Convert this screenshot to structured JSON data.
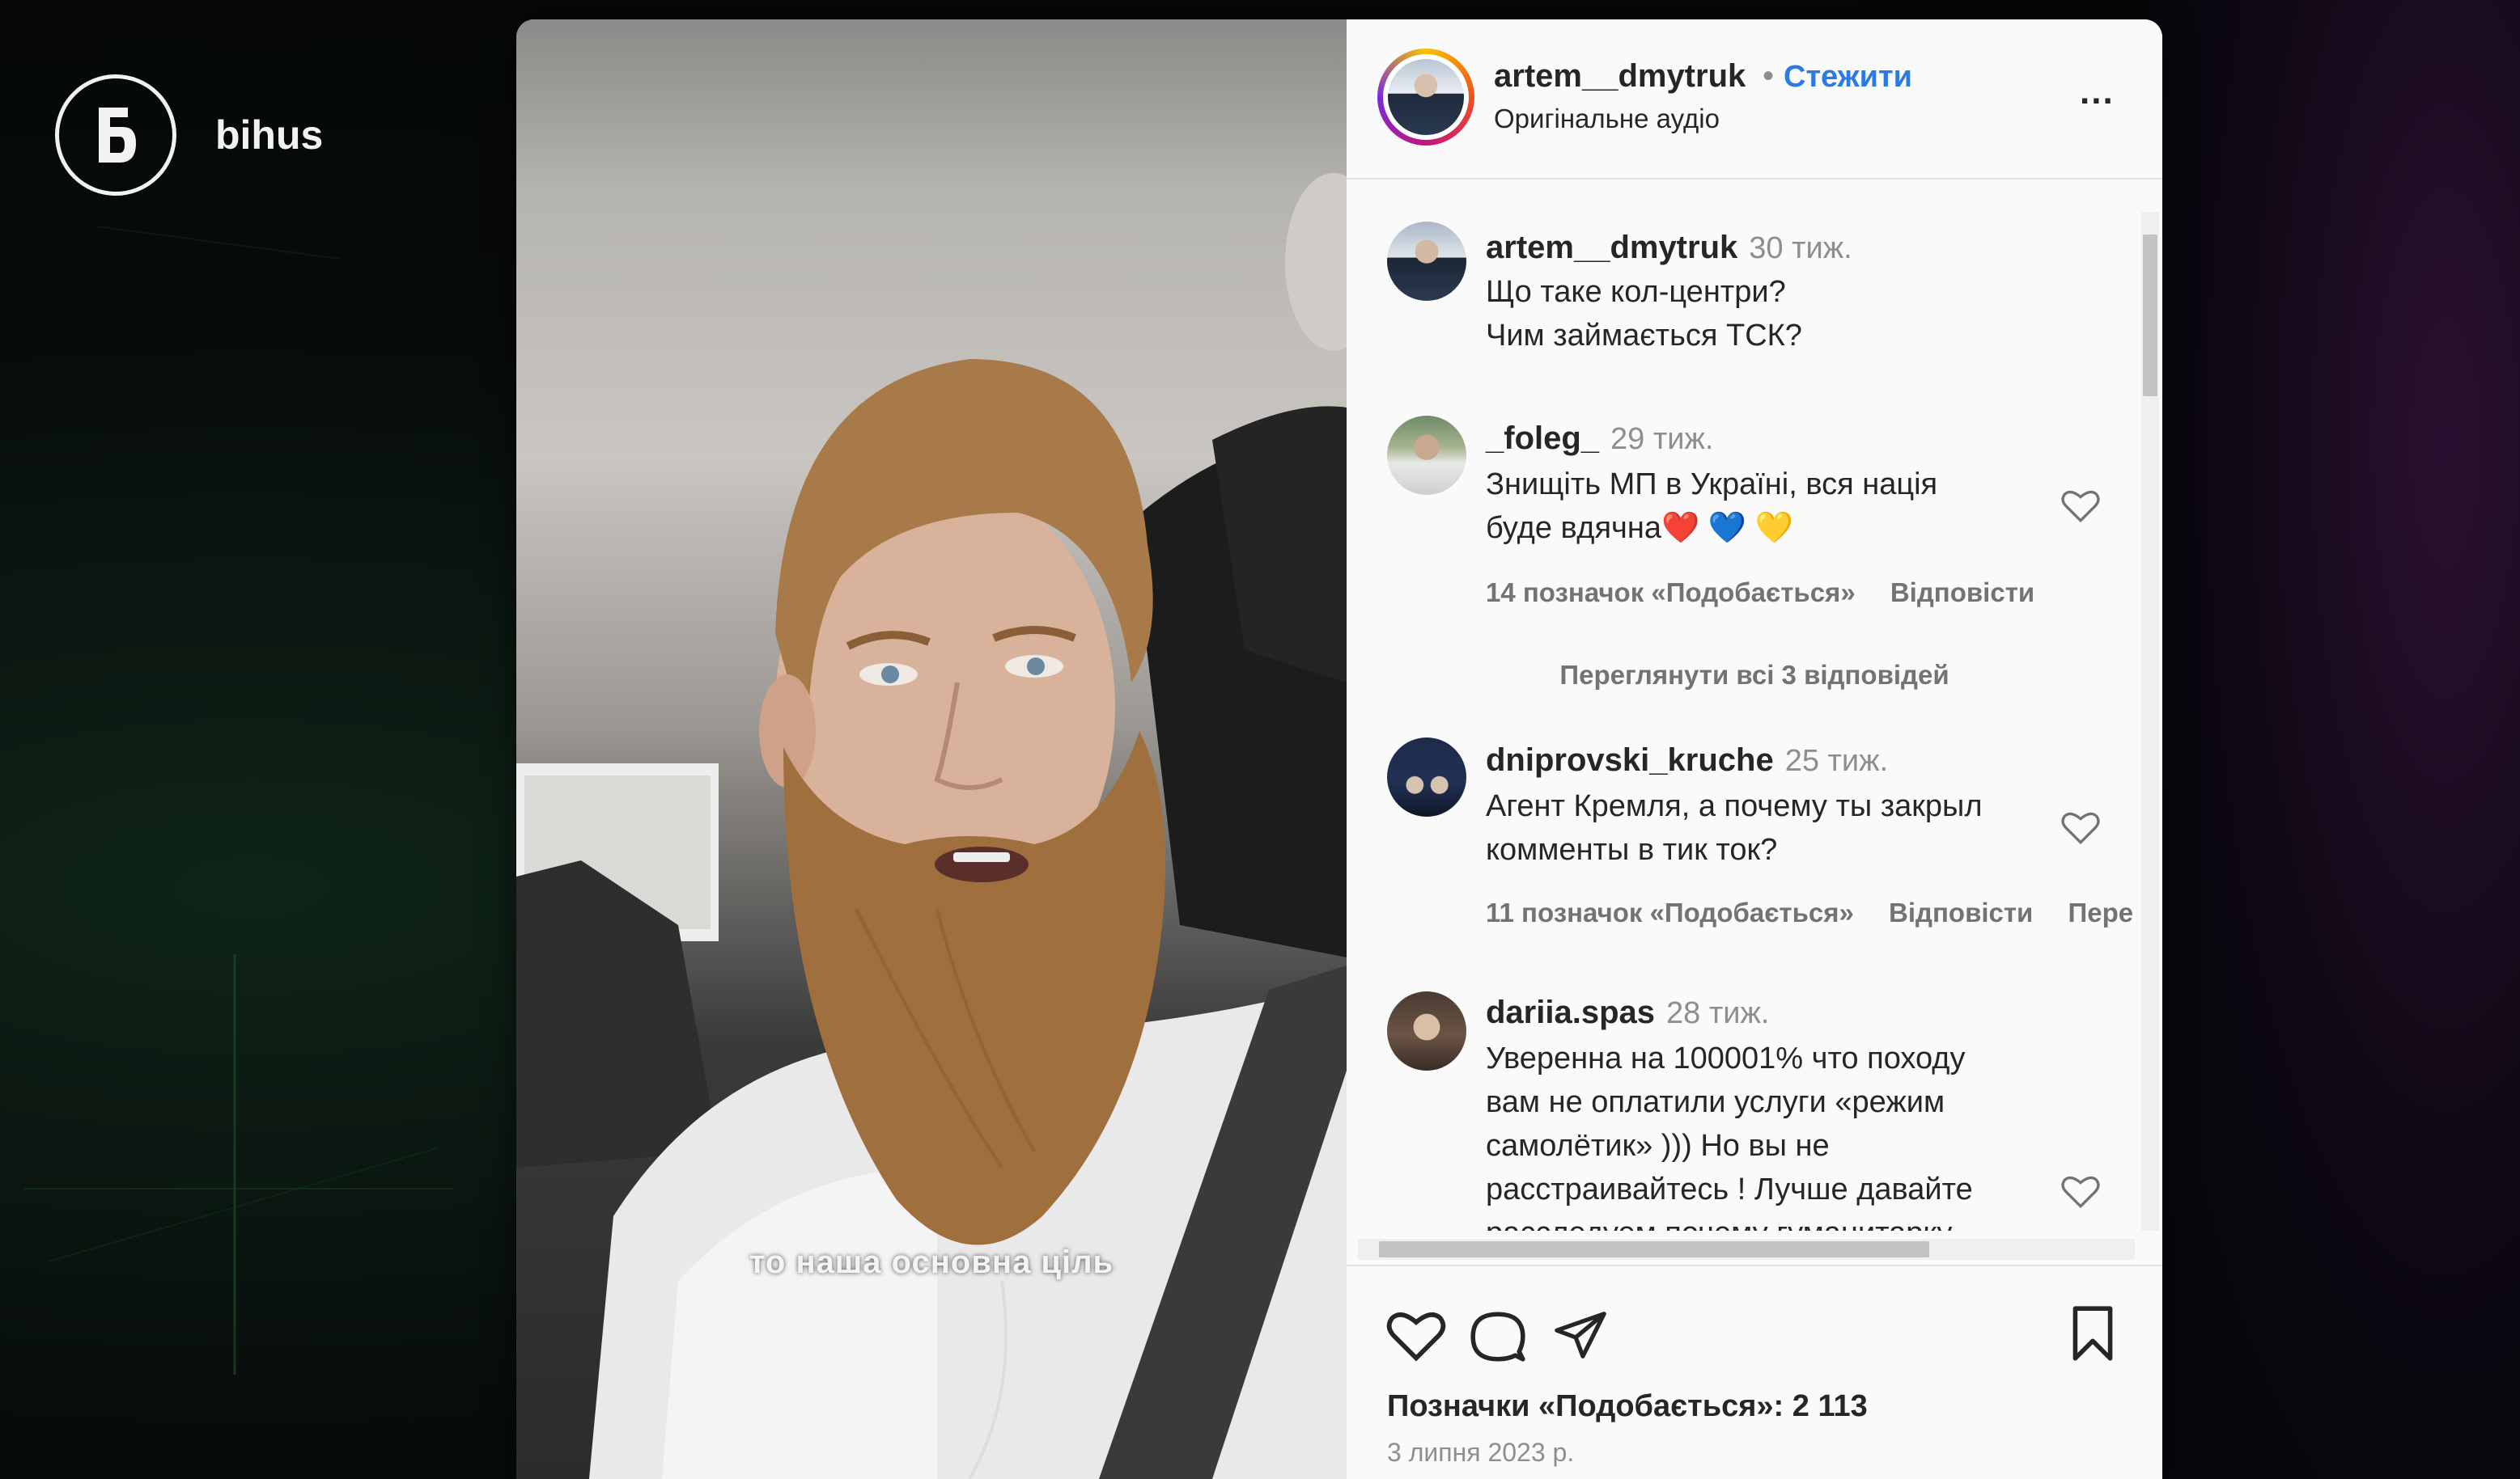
{
  "brand": {
    "name": "bihus",
    "logo_icon": "bihus-logo-icon"
  },
  "video": {
    "subtitle": "то наша основна ціль"
  },
  "post_header": {
    "username": "artem__dmytruk",
    "separator": "•",
    "follow_label": "Стежити",
    "audio_label": "Оригінальне аудіо",
    "more_label": "..."
  },
  "comments": [
    {
      "username": "artem__dmytruk",
      "time": "30 тиж.",
      "lines": [
        "Що таке кол-центри?",
        "Чим займається ТСК?"
      ]
    },
    {
      "username": "_foleg_",
      "time": "29 тиж.",
      "lines": [
        "Знищіть МП в Україні, вся нація",
        "буде вдячна❤️ 💙 💛"
      ],
      "likes_label": "14 позначок «Подобається»",
      "reply_label": "Відповісти"
    },
    {
      "username": "dniprovski_kruche",
      "time": "25 тиж.",
      "lines": [
        "Агент Кремля, а почему ты закрыл",
        "комменты в тик ток?"
      ],
      "likes_label": "11 позначок «Подобається»",
      "reply_label": "Відповісти",
      "translate_label": "Пере"
    },
    {
      "username": "dariia.spas",
      "time": "28 тиж.",
      "lines": [
        "Уверенна на 100001% что походу",
        "вам не оплатили услуги «режим",
        "самолётик» ))) Но вы не",
        "расстраивайтесь ! Лучше давайте",
        "расследуем почему гуманитарку"
      ]
    }
  ],
  "view_replies_label": "Переглянути всі 3 відповідей",
  "post_footer": {
    "likes_label": "Позначки «Подобається»: 2 113",
    "date": "3 липня 2023 р."
  },
  "colors": {
    "accent_link": "#2b7be0",
    "text": "#262626",
    "muted": "#8e8e8e",
    "panel_bg": "#fafafa"
  }
}
